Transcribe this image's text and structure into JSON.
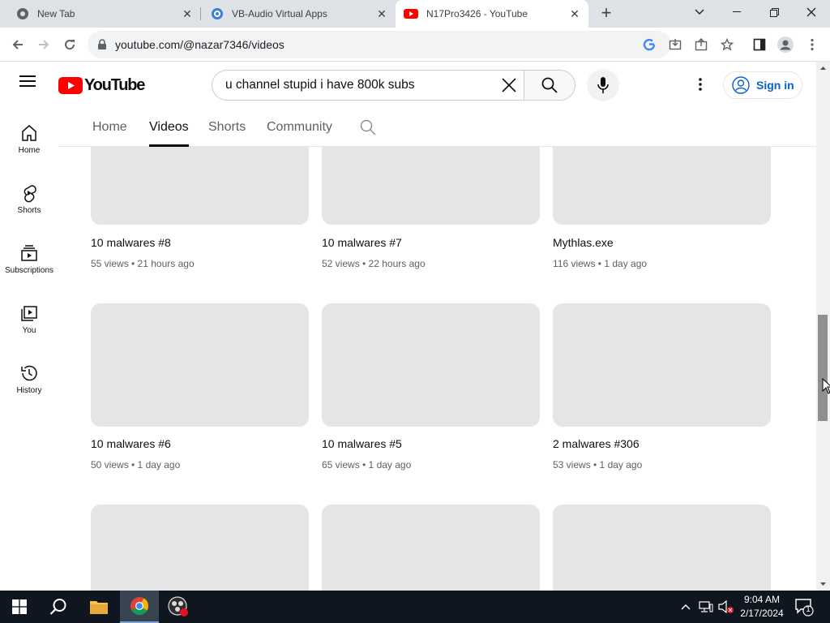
{
  "browser": {
    "tabs": [
      {
        "title": "New Tab"
      },
      {
        "title": "VB-Audio Virtual Apps"
      },
      {
        "title": "N17Pro3426 - YouTube"
      }
    ],
    "url": "youtube.com/@nazar7346/videos"
  },
  "youtube": {
    "logo_text": "YouTube",
    "search_query": "u channel stupid i have 800k subs",
    "signin_label": "Sign in",
    "sidebar": [
      {
        "label": "Home",
        "icon": "home-icon"
      },
      {
        "label": "Shorts",
        "icon": "shorts-icon"
      },
      {
        "label": "Subscriptions",
        "icon": "subscriptions-icon"
      },
      {
        "label": "You",
        "icon": "you-icon"
      },
      {
        "label": "History",
        "icon": "history-icon"
      }
    ],
    "channel_tabs": [
      "Home",
      "Videos",
      "Shorts",
      "Community"
    ],
    "active_tab": "Videos",
    "videos": [
      {
        "title": "10 malwares #8",
        "meta": "55 views • 21 hours ago"
      },
      {
        "title": "10 malwares #7",
        "meta": "52 views • 22 hours ago"
      },
      {
        "title": "Mythlas.exe",
        "meta": "116 views • 1 day ago"
      },
      {
        "title": "10 malwares #6",
        "meta": "50 views • 1 day ago"
      },
      {
        "title": "10 malwares #5",
        "meta": "65 views • 1 day ago"
      },
      {
        "title": "2 malwares #306",
        "meta": "53 views • 1 day ago"
      }
    ]
  },
  "taskbar": {
    "time": "9:04 AM",
    "date": "2/17/2024",
    "notification_count": "1"
  },
  "colors": {
    "youtube_red": "#ff0000",
    "link_blue": "#065fd4",
    "taskbar_bg": "#10161f"
  }
}
